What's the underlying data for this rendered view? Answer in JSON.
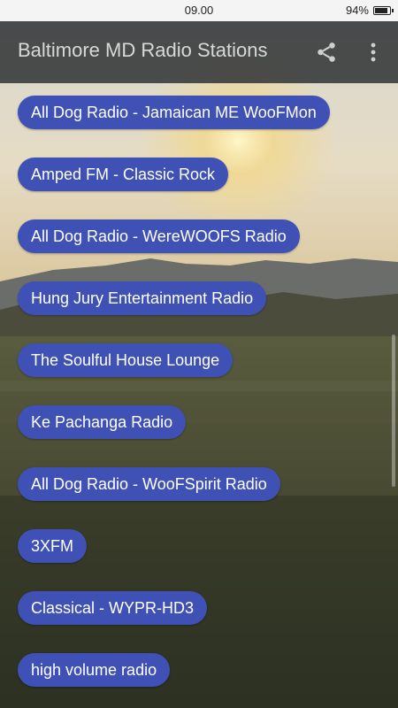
{
  "status_bar": {
    "time": "09.00",
    "battery": "94%"
  },
  "app_bar": {
    "title": "Baltimore MD Radio Stations"
  },
  "icons": {
    "share": "share-icon",
    "more": "more-vertical-icon"
  },
  "stations": [
    {
      "label": "All Dog Radio - Jamaican ME WooFMon"
    },
    {
      "label": "Amped FM - Classic Rock"
    },
    {
      "label": "All Dog Radio - WereWOOFS Radio"
    },
    {
      "label": "Hung Jury Entertainment Radio"
    },
    {
      "label": "The Soulful House Lounge"
    },
    {
      "label": "Ke Pachanga Radio"
    },
    {
      "label": "All Dog Radio - WooFSpirit Radio"
    },
    {
      "label": "3XFM"
    },
    {
      "label": "Classical - WYPR-HD3"
    },
    {
      "label": "high volume radio"
    }
  ],
  "colors": {
    "chip": "#3f51b5",
    "app_bar": "#2c3032"
  }
}
